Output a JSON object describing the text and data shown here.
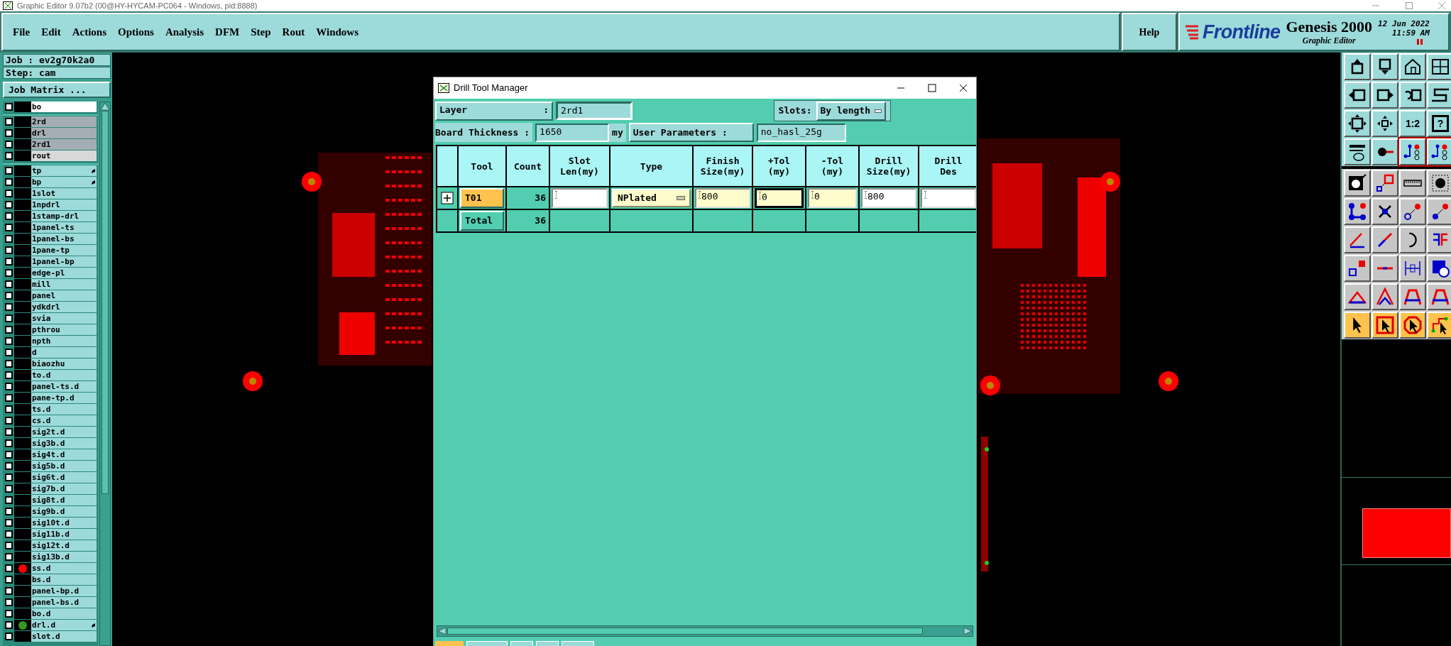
{
  "window": {
    "title": "Graphic Editor 9.07b2 (00@HY-HYCAM-PC064 - Windows, pid:8888)"
  },
  "menu": [
    "File",
    "Edit",
    "Actions",
    "Options",
    "Analysis",
    "DFM",
    "Step",
    "Rout",
    "Windows"
  ],
  "help": "Help",
  "brand": {
    "logo": "Frontline",
    "product": "Genesis 2000",
    "subtitle": "Graphic Editor",
    "date": "12 Jun 2022",
    "time": "11:59 AM"
  },
  "job": {
    "job": "Job : ev2g70k2a0",
    "step": "Step: cam",
    "matrix_button": "Job Matrix ..."
  },
  "layer_groups": [
    [
      {
        "name": "bo",
        "kind": "work",
        "marker": false,
        "checked": false
      }
    ],
    [
      {
        "name": "2rd",
        "kind": "board",
        "marker": false,
        "checked": false
      },
      {
        "name": "drl",
        "kind": "board",
        "marker": false,
        "checked": false
      },
      {
        "name": "2rd1",
        "kind": "board",
        "marker": false,
        "checked": false
      },
      {
        "name": "rout",
        "kind": "rout",
        "marker": false,
        "checked": false
      }
    ],
    [
      {
        "name": "tp",
        "kind": "misc",
        "marker": true,
        "checked": false
      },
      {
        "name": "bp",
        "kind": "misc",
        "marker": true,
        "checked": false
      },
      {
        "name": "1slot",
        "kind": "misc",
        "marker": false,
        "checked": false
      },
      {
        "name": "1npdrl",
        "kind": "misc",
        "marker": false,
        "checked": false
      },
      {
        "name": "1stamp-drl",
        "kind": "misc",
        "marker": false,
        "checked": false
      },
      {
        "name": "1panel-ts",
        "kind": "misc",
        "marker": false,
        "checked": false
      },
      {
        "name": "1panel-bs",
        "kind": "misc",
        "marker": false,
        "checked": false
      },
      {
        "name": "1pane-tp",
        "kind": "misc",
        "marker": false,
        "checked": false
      },
      {
        "name": "1panel-bp",
        "kind": "misc",
        "marker": false,
        "checked": false
      },
      {
        "name": "edge-pl",
        "kind": "misc",
        "marker": false,
        "checked": false
      },
      {
        "name": "mill",
        "kind": "misc",
        "marker": false,
        "checked": false
      },
      {
        "name": "panel",
        "kind": "misc",
        "marker": false,
        "checked": false
      },
      {
        "name": "ydkdrl",
        "kind": "misc",
        "marker": false,
        "checked": false
      },
      {
        "name": "svia",
        "kind": "misc",
        "marker": false,
        "checked": false
      },
      {
        "name": "pthrou",
        "kind": "misc",
        "marker": false,
        "checked": false
      },
      {
        "name": "npth",
        "kind": "misc",
        "marker": false,
        "checked": false
      },
      {
        "name": "d",
        "kind": "misc",
        "marker": false,
        "checked": false
      },
      {
        "name": "biaozhu",
        "kind": "misc",
        "marker": false,
        "checked": false
      },
      {
        "name": "to.d",
        "kind": "misc",
        "marker": false,
        "checked": false
      },
      {
        "name": "panel-ts.d",
        "kind": "misc",
        "marker": false,
        "checked": false
      },
      {
        "name": "pane-tp.d",
        "kind": "misc",
        "marker": false,
        "checked": false
      },
      {
        "name": "ts.d",
        "kind": "misc",
        "marker": false,
        "checked": false
      },
      {
        "name": "cs.d",
        "kind": "misc",
        "marker": false,
        "checked": false
      },
      {
        "name": "sig2t.d",
        "kind": "misc",
        "marker": false,
        "checked": false
      },
      {
        "name": "sig3b.d",
        "kind": "misc",
        "marker": false,
        "checked": false
      },
      {
        "name": "sig4t.d",
        "kind": "misc",
        "marker": false,
        "checked": false
      },
      {
        "name": "sig5b.d",
        "kind": "misc",
        "marker": false,
        "checked": false
      },
      {
        "name": "sig6t.d",
        "kind": "misc",
        "marker": false,
        "checked": false
      },
      {
        "name": "sig7b.d",
        "kind": "misc",
        "marker": false,
        "checked": false
      },
      {
        "name": "sig8t.d",
        "kind": "misc",
        "marker": false,
        "checked": false
      },
      {
        "name": "sig9b.d",
        "kind": "misc",
        "marker": false,
        "checked": false
      },
      {
        "name": "sig10t.d",
        "kind": "misc",
        "marker": false,
        "checked": false
      },
      {
        "name": "sig11b.d",
        "kind": "misc",
        "marker": false,
        "checked": false
      },
      {
        "name": "sig12t.d",
        "kind": "misc",
        "marker": false,
        "checked": false
      },
      {
        "name": "sig13b.d",
        "kind": "misc",
        "marker": false,
        "checked": false
      },
      {
        "name": "ss.d",
        "kind": "misc",
        "marker": false,
        "checked": false,
        "color": "#ff0000"
      },
      {
        "name": "bs.d",
        "kind": "misc",
        "marker": false,
        "checked": false
      },
      {
        "name": "panel-bp.d",
        "kind": "misc",
        "marker": false,
        "checked": false
      },
      {
        "name": "panel-bs.d",
        "kind": "misc",
        "marker": false,
        "checked": false
      },
      {
        "name": "bo.d",
        "kind": "misc",
        "marker": false,
        "checked": false
      },
      {
        "name": "drl.d",
        "kind": "misc",
        "marker": true,
        "checked": false,
        "color": "#339922"
      },
      {
        "name": "slot.d",
        "kind": "misc",
        "marker": false,
        "checked": false
      }
    ]
  ],
  "toolbar": {
    "ratio_label": "1:2",
    "query_label": "?"
  },
  "dialog": {
    "title": "Drill Tool Manager",
    "layer_label": [
      "Layer",
      ":"
    ],
    "layer_value": "2rd1",
    "slots_label": "Slots:",
    "slots_value": "By length",
    "thickness_label": "Board Thickness :",
    "thickness_value": "1650",
    "thickness_unit": "my",
    "user_params_button": "User Parameters :",
    "user_params_value": "no_hasl_25g",
    "columns": [
      "Tool",
      "Count",
      "Slot\nLen(my)",
      "Type",
      "Finish\nSize(my)",
      "+Tol\n(my)",
      "-Tol\n(my)",
      "Drill\nSize(my)",
      "Drill\nDes"
    ],
    "rows": [
      {
        "expandable": true,
        "cells": [
          {
            "kind": "button",
            "value": "T01",
            "selected": true
          },
          {
            "kind": "number",
            "value": "36"
          },
          {
            "kind": "input",
            "highlighted": false,
            "focused": false
          },
          {
            "kind": "select",
            "value": "NPlated"
          },
          {
            "kind": "input",
            "value": "800",
            "highlighted": true,
            "focused": false
          },
          {
            "kind": "input",
            "value": "0",
            "highlighted": true,
            "focused": true
          },
          {
            "kind": "input",
            "value": "0",
            "highlighted": true,
            "focused": false
          },
          {
            "kind": "input",
            "value": "800",
            "highlighted": false,
            "focused": false
          },
          {
            "kind": "input",
            "highlighted": false,
            "focused": false
          }
        ]
      },
      {
        "expandable": false,
        "cells": [
          {
            "kind": "button",
            "value": "Total",
            "selected": false
          },
          {
            "kind": "number",
            "value": "36"
          },
          {
            "kind": "empty"
          },
          {
            "kind": "empty"
          },
          {
            "kind": "empty"
          },
          {
            "kind": "empty"
          },
          {
            "kind": "empty"
          },
          {
            "kind": "empty"
          },
          {
            "kind": "empty"
          }
        ]
      }
    ]
  }
}
